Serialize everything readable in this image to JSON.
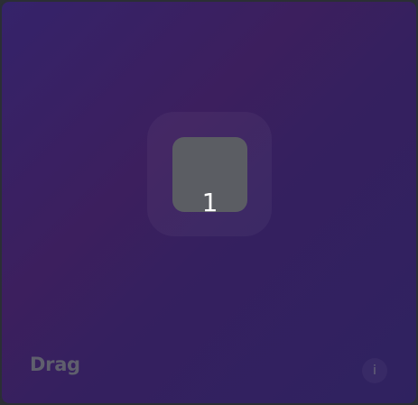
{
  "demo": {
    "title": "Drag",
    "card_label": "1",
    "info_icon": "i"
  },
  "colors": {
    "background_start": "#35236a",
    "background_mid": "#3c1f5e",
    "card": "#5b5d63",
    "label": "#5f5f6d"
  }
}
